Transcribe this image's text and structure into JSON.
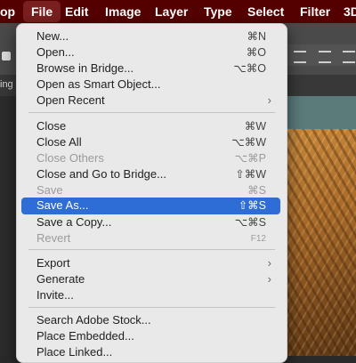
{
  "menubar": {
    "app": "op",
    "file": "File",
    "edit": "Edit",
    "image": "Image",
    "layer": "Layer",
    "type": "Type",
    "select": "Select",
    "filter": "Filter",
    "more": "3D"
  },
  "tab": {
    "label": "ing @"
  },
  "file_menu": {
    "new": {
      "label": "New...",
      "shortcut": "⌘N"
    },
    "open": {
      "label": "Open...",
      "shortcut": "⌘O"
    },
    "browse": {
      "label": "Browse in Bridge...",
      "shortcut": "⌥⌘O"
    },
    "open_smart": {
      "label": "Open as Smart Object..."
    },
    "open_recent": {
      "label": "Open Recent",
      "arrow": "›"
    },
    "close": {
      "label": "Close",
      "shortcut": "⌘W"
    },
    "close_all": {
      "label": "Close All",
      "shortcut": "⌥⌘W"
    },
    "close_others": {
      "label": "Close Others",
      "shortcut": "⌥⌘P"
    },
    "close_bridge": {
      "label": "Close and Go to Bridge...",
      "shortcut": "⇧⌘W"
    },
    "save": {
      "label": "Save",
      "shortcut": "⌘S"
    },
    "save_as": {
      "label": "Save As...",
      "shortcut": "⇧⌘S"
    },
    "save_copy": {
      "label": "Save a Copy...",
      "shortcut": "⌥⌘S"
    },
    "revert": {
      "label": "Revert",
      "shortcut": "F12"
    },
    "export": {
      "label": "Export",
      "arrow": "›"
    },
    "generate": {
      "label": "Generate",
      "arrow": "›"
    },
    "invite": {
      "label": "Invite..."
    },
    "search_stock": {
      "label": "Search Adobe Stock..."
    },
    "place_embedded": {
      "label": "Place Embedded..."
    },
    "place_linked": {
      "label": "Place Linked..."
    }
  },
  "colors": {
    "menubar_bg": "#550000",
    "menu_bg": "#e9e9e9",
    "highlight": "#2f6dd6"
  }
}
